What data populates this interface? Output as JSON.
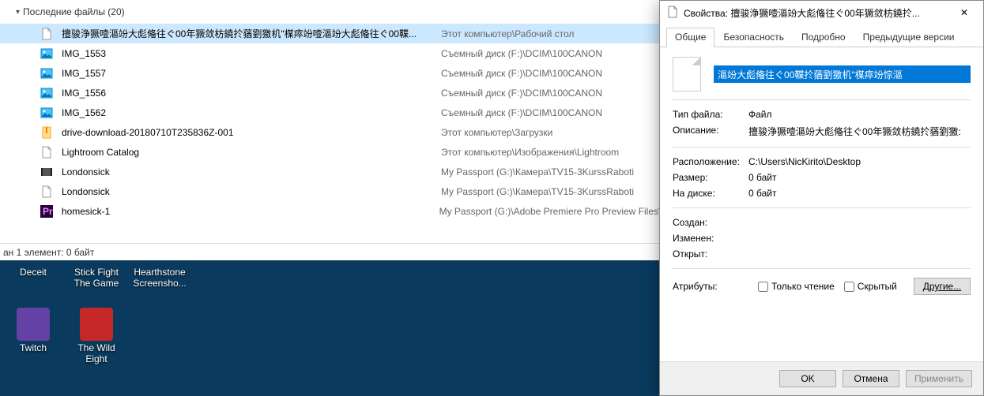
{
  "explorer": {
    "section_title": "Последние файлы (20)",
    "files": [
      {
        "icon": "file",
        "name": "擅骏浄獗噎漚竕⼤彪偹往ぐ00年獗敛枋鐃扵蕕劉獥机\"楳瘁竕噎漚竕⼤彪偹往ぐ00鞢...",
        "path": "Этот компьютер\\Рабочий стол",
        "selected": true
      },
      {
        "icon": "image",
        "name": "IMG_1553",
        "path": "Съемный диск (F:)\\DCIM\\100CANON"
      },
      {
        "icon": "image",
        "name": "IMG_1557",
        "path": "Съемный диск (F:)\\DCIM\\100CANON"
      },
      {
        "icon": "image",
        "name": "IMG_1556",
        "path": "Съемный диск (F:)\\DCIM\\100CANON"
      },
      {
        "icon": "image",
        "name": "IMG_1562",
        "path": "Съемный диск (F:)\\DCIM\\100CANON"
      },
      {
        "icon": "zip",
        "name": "drive-download-20180710T235836Z-001",
        "path": "Этот компьютер\\Загрузки"
      },
      {
        "icon": "file",
        "name": "Lightroom Catalog",
        "path": "Этот компьютер\\Изображения\\Lightroom"
      },
      {
        "icon": "video",
        "name": "Londonsick",
        "path": "My Passport (G:)\\Камера\\TV15-3KurssRaboti"
      },
      {
        "icon": "file",
        "name": "Londonsick",
        "path": "My Passport (G:)\\Камера\\TV15-3KurssRaboti"
      },
      {
        "icon": "premiere",
        "name": "homesick-1",
        "path": "My Passport (G:)\\Adobe Premiere Pro Preview Files\\"
      }
    ],
    "status": "ан 1 элемент: 0 байт"
  },
  "desktop": {
    "row1": [
      {
        "label": "Deceit",
        "color": "#0a3a5e"
      },
      {
        "label": "Stick Fight The Game",
        "color": "#0a3a5e"
      },
      {
        "label": "Hearthstone Screensho...",
        "color": "#0a3a5e"
      }
    ],
    "row2": [
      {
        "label": "Twitch",
        "color": "#6441a5"
      },
      {
        "label": "The Wild Eight",
        "color": "#c62828"
      }
    ]
  },
  "dialog": {
    "title": "Свойства: 擅骏浄獗噎漚竕⼤彪偹往ぐ00年獗敛枋鐃扵...",
    "tabs": [
      "Общие",
      "Безопасность",
      "Подробно",
      "Предыдущие версии"
    ],
    "filename": "漚竕⼤彪偹往ぐ00鞢扵蕕劉獥机\"楳瘁竕悰漚",
    "rows": {
      "type_k": "Тип файла:",
      "type_v": "Файл",
      "desc_k": "Описание:",
      "desc_v": "擅骏浄獗噎漚竕⼤彪偹往ぐ00年獗敛枋鐃扵蕕劉獥:",
      "loc_k": "Расположение:",
      "loc_v": "C:\\Users\\NicKirito\\Desktop",
      "size_k": "Размер:",
      "size_v": "0 байт",
      "disk_k": "На диске:",
      "disk_v": "0 байт",
      "created_k": "Создан:",
      "created_v": "",
      "modified_k": "Изменен:",
      "modified_v": "",
      "opened_k": "Открыт:",
      "opened_v": "",
      "attr_k": "Атрибуты:"
    },
    "checks": {
      "readonly": "Только чтение",
      "hidden": "Скрытый"
    },
    "other_btn": "Другие...",
    "buttons": {
      "ok": "OK",
      "cancel": "Отмена",
      "apply": "Применить"
    }
  }
}
